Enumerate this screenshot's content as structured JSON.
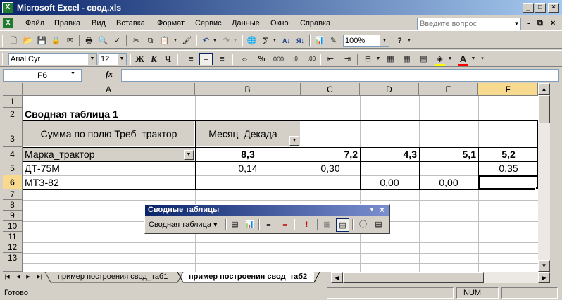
{
  "window": {
    "title": "Microsoft Excel - свод.xls",
    "controls": [
      "_",
      "□",
      "×"
    ],
    "app_icon": "excel-icon"
  },
  "menu": [
    "Файл",
    "Правка",
    "Вид",
    "Вставка",
    "Формат",
    "Сервис",
    "Данные",
    "Окно",
    "Справка"
  ],
  "menu_accel": [
    "Ф",
    "П",
    "В",
    "т",
    "Ф",
    "С",
    "Д",
    "О",
    "С"
  ],
  "help_placeholder": "Введите вопрос",
  "mdi_controls": [
    "-",
    "⧉",
    "×"
  ],
  "standard_toolbar": {
    "zoom": "100%",
    "buttons": [
      "new-icon",
      "open-icon",
      "save-icon",
      "permission-icon",
      "email-icon",
      "print-icon",
      "print-preview-icon",
      "spelling-icon",
      "cut-icon",
      "copy-icon",
      "paste-icon",
      "format-painter-icon",
      "undo-icon",
      "redo-icon",
      "hyperlink-icon",
      "autosum-icon",
      "sort-ascending-icon",
      "sort-descending-icon",
      "chart-wizard-icon",
      "drawing-icon",
      "help-icon"
    ]
  },
  "format_toolbar": {
    "font": "Arial Cyr",
    "size": "12",
    "bold": "Ж",
    "italic": "К",
    "underline": "Ч",
    "buttons": [
      "align-left-icon",
      "align-center-icon",
      "align-right-icon",
      "merge-center-icon",
      "currency-icon",
      "percent-icon",
      "thousands-icon",
      "increase-decimal-icon",
      "decrease-decimal-icon",
      "decrease-indent-icon",
      "increase-indent-icon",
      "borders-icon",
      "fill-color-icon",
      "font-color-icon"
    ]
  },
  "formula_bar": {
    "name_box": "F6",
    "fx": "fx",
    "formula": ""
  },
  "columns": [
    "A",
    "B",
    "C",
    "D",
    "E",
    "F"
  ],
  "rows": [
    "1",
    "2",
    "3",
    "4",
    "5",
    "6",
    "7",
    "8",
    "9",
    "10",
    "11",
    "12",
    "13"
  ],
  "sheet": {
    "title": "Сводная таблица 1",
    "data_field": "Сумма по полю Треб_трактор",
    "column_field": "Месяц_Декада",
    "row_field": "Марка_трактор",
    "column_items": [
      "8,3",
      "7,2",
      "4,3",
      "5,1",
      "5,2"
    ],
    "row_items": [
      {
        "label": "ДТ-75М",
        "values": [
          "0,14",
          "0,30",
          "",
          "",
          "0,35"
        ]
      },
      {
        "label": "МТЗ-82",
        "values": [
          "",
          "",
          "0,00",
          "0,00",
          ""
        ]
      }
    ]
  },
  "pivot_toolbar": {
    "title": "Сводные таблицы",
    "menu_label": "Сводная таблица",
    "menu_accel": "Сводная таблица",
    "buttons": [
      "format-report-icon",
      "pivot-chart-icon",
      "hide-detail-icon",
      "show-detail-icon",
      "refresh-data-icon",
      "include-hidden-icon",
      "always-display-items-icon",
      "field-settings-icon",
      "field-list-icon"
    ]
  },
  "sheet_tabs": [
    {
      "label": "пример построения свод_таб1",
      "active": false
    },
    {
      "label": "пример построения свод_таб2",
      "active": true
    }
  ],
  "status": {
    "text": "Готово",
    "num": "NUM"
  },
  "colors": {
    "title_start": "#0a246a",
    "title_end": "#a6caf0",
    "chrome": "#d4d0c8",
    "font_color_bar": "#ff0000",
    "highlight_bar": "#ffff00"
  }
}
